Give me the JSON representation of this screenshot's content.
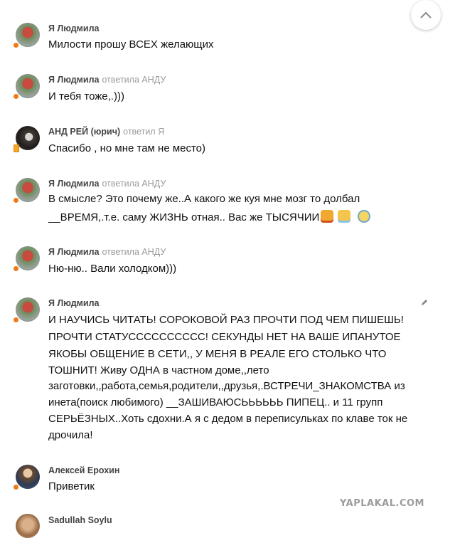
{
  "comments": [
    {
      "author": "Я Людмила",
      "reply_label": "",
      "reply_to": "",
      "lines": [
        "Милости прошу ВСЕХ желающих"
      ]
    },
    {
      "author": "Я Людмила",
      "reply_label": "ответила",
      "reply_to": "АНДУ",
      "lines": [
        "И тебя тоже,.)))"
      ]
    },
    {
      "author": "АНД РЕЙ (юрич)",
      "reply_label": "ответил",
      "reply_to": "Я",
      "lines": [
        "Спасибо , но мне там не место)"
      ]
    },
    {
      "author": "Я Людмила",
      "reply_label": "ответила",
      "reply_to": "АНДУ",
      "lines": [
        "В смысле? Это почему же..А какого же куя мне мозг то долбал",
        "__ВРЕМЯ,.т.е. саму ЖИЗНЬ отная.. Вас же ТЫСЯЧИИ"
      ]
    },
    {
      "author": "Я Людмила",
      "reply_label": "ответила",
      "reply_to": "АНДУ",
      "lines": [
        "Ню-ню..  Вали холодком)))"
      ]
    },
    {
      "author": "Я Людмила",
      "reply_label": "",
      "reply_to": "",
      "lines": [
        "И НАУЧИСЬ ЧИТАТЬ! СОРОКОВОЙ РАЗ ПРОЧТИ ПОД ЧЕМ ПИШЕШЬ!",
        "ПРОЧТИ СТАТУСССССССССС! СЕКУНДЫ НЕТ НА ВАШЕ ИПАНУТОЕ",
        "ЯКОБЫ ОБЩЕНИЕ В СЕТИ,, У МЕНЯ В РЕАЛЕ ЕГО СТОЛЬКО ЧТО",
        "ТОШНИТ!  Живу ОДНА в частном доме,,лето",
        "заготовки,,работа,семья,родители,,друзья,.ВСТРЕЧИ_ЗНАКОМСТВА из",
        "инета(поиск любимого) __ЗАШИВАЮСЬЬЬЬЬЬ ПИПЕЦ.. и 11 групп",
        "СЕРЬЁЗНЫХ..Хоть сдохни.А я с дедом в переписульках по клаве  ток не",
        "дрочила!"
      ]
    },
    {
      "author": "Алексей Ерохин",
      "reply_label": "",
      "reply_to": "",
      "lines": [
        "Приветик"
      ]
    },
    {
      "author": "Sadullah Soylu",
      "reply_label": "",
      "reply_to": "",
      "lines": []
    }
  ],
  "icons": {
    "scroll_top": "chevron-up-icon",
    "edit": "pencil-icon",
    "emojis": [
      "angry-cat-emoji",
      "crying-cat-emoji",
      "screaming-face-emoji"
    ]
  },
  "watermark": "YAPLAKAL.COM",
  "colors": {
    "status_dot": "#f07a1a",
    "meta_text": "#9a9a9a"
  }
}
